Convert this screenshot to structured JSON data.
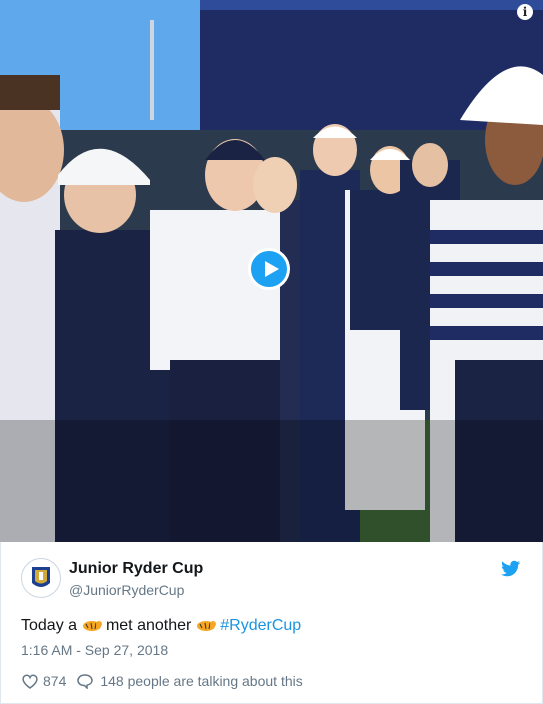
{
  "tweet": {
    "name": "Junior Ryder Cup",
    "handle": "@JuniorRyderCup",
    "text_before": "Today a",
    "text_middle": "met another",
    "hashtag": "#RyderCup",
    "timestamp": "1:16 AM - Sep 27, 2018",
    "likes": "874",
    "replies": "148 people are talking about this"
  },
  "colors": {
    "accent": "#1da1f2",
    "hashtag": "#1b95e0",
    "muted": "#657786"
  },
  "icons": [
    "info-icon",
    "play-icon",
    "twitter-bird-icon",
    "tiger-emoji-icon",
    "heart-icon",
    "comment-icon"
  ]
}
